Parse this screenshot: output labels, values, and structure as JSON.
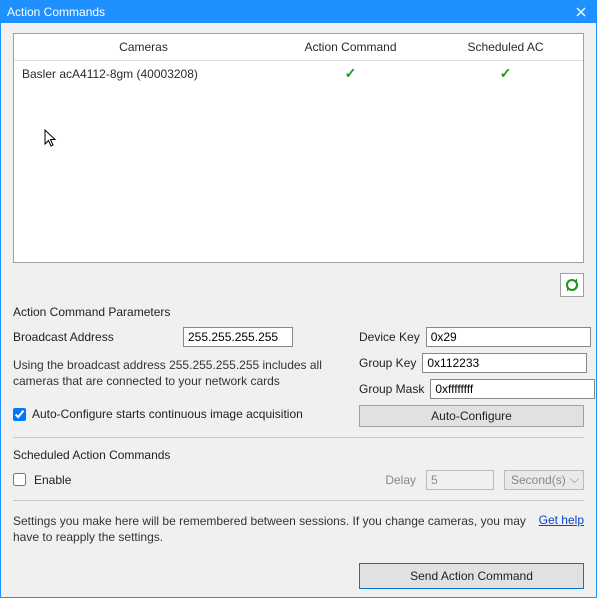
{
  "title": "Action Commands",
  "columns": {
    "cameras": "Cameras",
    "action_command": "Action Command",
    "scheduled_ac": "Scheduled AC"
  },
  "rows": [
    {
      "camera": "Basler acA4112-8gm (40003208)",
      "ac": "✓",
      "sc": "✓"
    }
  ],
  "params_title": "Action Command Parameters",
  "broadcast": {
    "label": "Broadcast Address",
    "value": "255.255.255.255"
  },
  "hint": "Using the broadcast address 255.255.255.255 includes all cameras that are connected to your network cards",
  "device_key": {
    "label": "Device Key",
    "value": "0x29"
  },
  "group_key": {
    "label": "Group Key",
    "value": "0x112233"
  },
  "group_mask": {
    "label": "Group Mask",
    "value": "0xffffffff"
  },
  "autoconf_checkbox": "Auto-Configure starts continuous image acquisition",
  "autoconf_button": "Auto-Configure",
  "sched_title": "Scheduled Action Commands",
  "enable_label": "Enable",
  "delay_label": "Delay",
  "delay_value": "5",
  "delay_unit": "Second(s)",
  "settings_note": "Settings you make here will be remembered between sessions. If you change cameras, you may have to reapply the settings.",
  "help_link": "Get help",
  "send_button": "Send Action Command"
}
